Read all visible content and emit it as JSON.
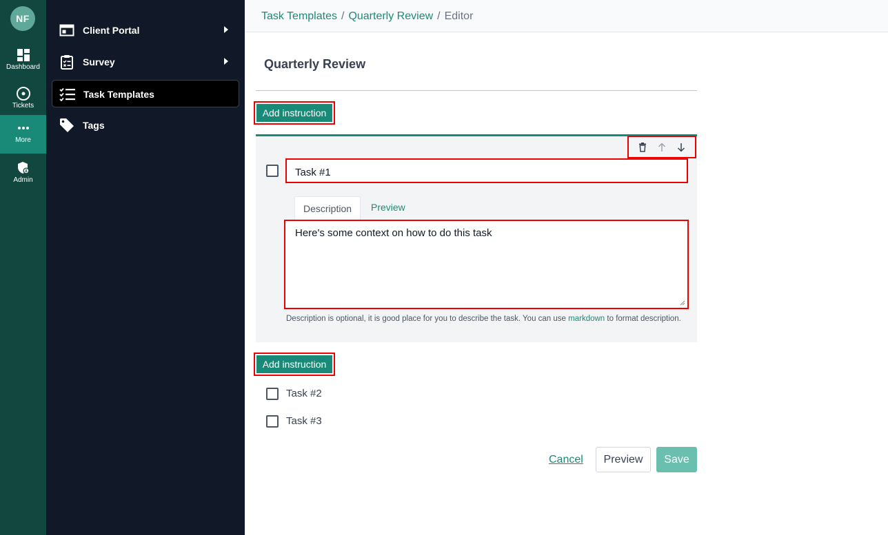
{
  "user": {
    "initials": "NF"
  },
  "rail": [
    {
      "label": "Dashboard",
      "icon": "dashboard-icon"
    },
    {
      "label": "Tickets",
      "icon": "ticket-icon"
    },
    {
      "label": "More",
      "icon": "more-icon",
      "active": true
    },
    {
      "label": "Admin",
      "icon": "admin-shield-icon"
    }
  ],
  "subnav": [
    {
      "label": "Client Portal",
      "icon": "portal-window-icon",
      "has_submenu": true
    },
    {
      "label": "Survey",
      "icon": "clipboard-icon",
      "has_submenu": true
    },
    {
      "label": "Task Templates",
      "icon": "checklist-icon",
      "active": true
    },
    {
      "label": "Tags",
      "icon": "tag-icon"
    }
  ],
  "breadcrumb": {
    "items": [
      "Task Templates",
      "Quarterly Review",
      "Editor"
    ],
    "separator": "/"
  },
  "page": {
    "title": "Quarterly Review"
  },
  "add_instruction_label": "Add instruction",
  "tasks": [
    {
      "title": "Task #1",
      "expanded": true,
      "tabs": [
        "Description",
        "Preview"
      ],
      "active_tab": "Description",
      "description": "Here's some context on how to do this task",
      "help_before": "Description is optional, it is good place for you to describe the task. You can use",
      "help_link": "markdown",
      "help_after": "to format description."
    },
    {
      "title": "Task #2"
    },
    {
      "title": "Task #3"
    }
  ],
  "actions": {
    "cancel": "Cancel",
    "preview": "Preview",
    "save": "Save"
  },
  "colors": {
    "accent": "#1a8a78",
    "rail_bg": "#12473f",
    "subnav_bg": "#111827",
    "highlight": "#ee0000"
  }
}
